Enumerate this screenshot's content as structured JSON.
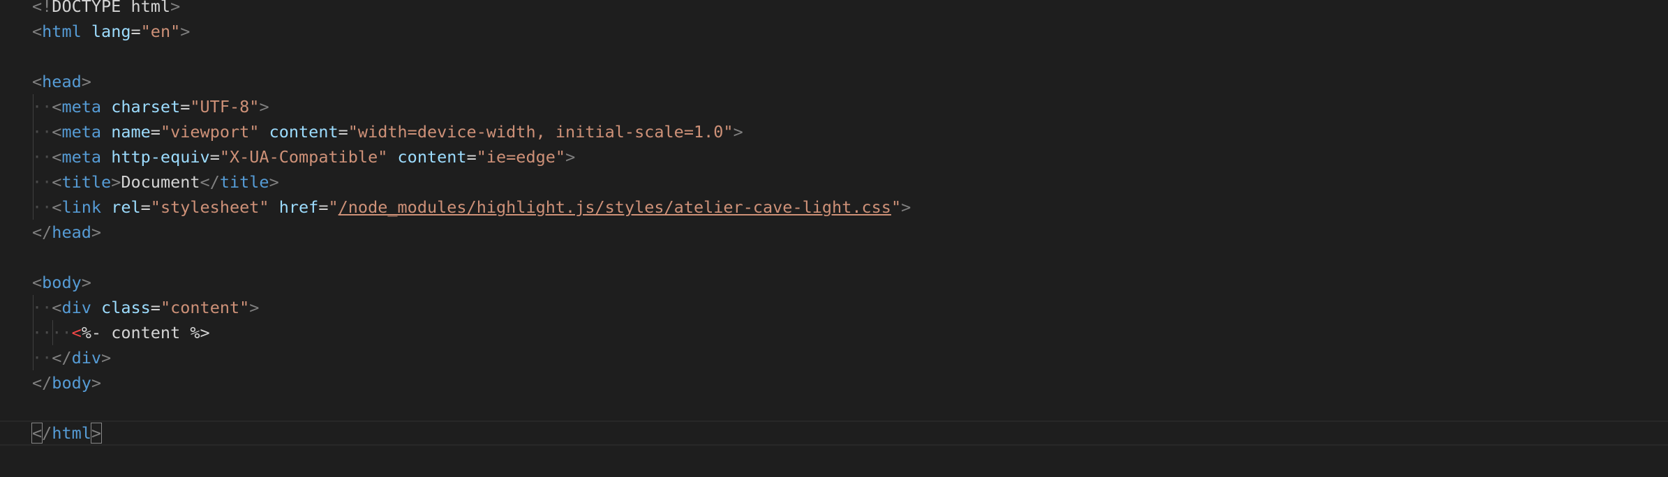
{
  "editor": {
    "language": "html",
    "colors": {
      "background": "#1e1e1e",
      "punctuation": "#808080",
      "tag": "#569cd6",
      "attribute": "#9cdcfe",
      "string": "#ce9178",
      "text": "#d4d4d4",
      "ejs_delimiter": "#f44747"
    },
    "lines": [
      {
        "tokens": [
          {
            "c": "p",
            "v": "<!"
          },
          {
            "c": "x",
            "v": "DOCTYPE html"
          },
          {
            "c": "p",
            "v": ">"
          }
        ]
      },
      {
        "tokens": [
          {
            "c": "p",
            "v": "<"
          },
          {
            "c": "t",
            "v": "html"
          },
          {
            "c": "a",
            "v": " lang"
          },
          {
            "c": "x",
            "v": "="
          },
          {
            "c": "s",
            "v": "\"en\""
          },
          {
            "c": "p",
            "v": ">"
          }
        ]
      },
      {
        "tokens": []
      },
      {
        "tokens": [
          {
            "c": "p",
            "v": "<"
          },
          {
            "c": "t",
            "v": "head"
          },
          {
            "c": "p",
            "v": ">"
          }
        ]
      },
      {
        "tokens": [
          {
            "c": "ws",
            "v": "··"
          },
          {
            "c": "p",
            "v": "<"
          },
          {
            "c": "t",
            "v": "meta"
          },
          {
            "c": "a",
            "v": " charset"
          },
          {
            "c": "x",
            "v": "="
          },
          {
            "c": "s",
            "v": "\"UTF-8\""
          },
          {
            "c": "p",
            "v": ">"
          }
        ]
      },
      {
        "tokens": [
          {
            "c": "ws",
            "v": "··"
          },
          {
            "c": "p",
            "v": "<"
          },
          {
            "c": "t",
            "v": "meta"
          },
          {
            "c": "a",
            "v": " name"
          },
          {
            "c": "x",
            "v": "="
          },
          {
            "c": "s",
            "v": "\"viewport\""
          },
          {
            "c": "a",
            "v": " content"
          },
          {
            "c": "x",
            "v": "="
          },
          {
            "c": "s",
            "v": "\"width=device-width, initial-scale=1.0\""
          },
          {
            "c": "p",
            "v": ">"
          }
        ]
      },
      {
        "tokens": [
          {
            "c": "ws",
            "v": "··"
          },
          {
            "c": "p",
            "v": "<"
          },
          {
            "c": "t",
            "v": "meta"
          },
          {
            "c": "a",
            "v": " http-equiv"
          },
          {
            "c": "x",
            "v": "="
          },
          {
            "c": "s",
            "v": "\"X-UA-Compatible\""
          },
          {
            "c": "a",
            "v": " content"
          },
          {
            "c": "x",
            "v": "="
          },
          {
            "c": "s",
            "v": "\"ie=edge\""
          },
          {
            "c": "p",
            "v": ">"
          }
        ]
      },
      {
        "tokens": [
          {
            "c": "ws",
            "v": "··"
          },
          {
            "c": "p",
            "v": "<"
          },
          {
            "c": "t",
            "v": "title"
          },
          {
            "c": "p",
            "v": ">"
          },
          {
            "c": "x",
            "v": "Document"
          },
          {
            "c": "p",
            "v": "</"
          },
          {
            "c": "t",
            "v": "title"
          },
          {
            "c": "p",
            "v": ">"
          }
        ]
      },
      {
        "tokens": [
          {
            "c": "ws",
            "v": "··"
          },
          {
            "c": "p",
            "v": "<"
          },
          {
            "c": "t",
            "v": "link"
          },
          {
            "c": "a",
            "v": " rel"
          },
          {
            "c": "x",
            "v": "="
          },
          {
            "c": "s",
            "v": "\"stylesheet\""
          },
          {
            "c": "a",
            "v": " href"
          },
          {
            "c": "x",
            "v": "="
          },
          {
            "c": "s",
            "v": "\""
          },
          {
            "c": "u",
            "v": "/node_modules/highlight.js/styles/atelier-cave-light.css"
          },
          {
            "c": "s",
            "v": "\""
          },
          {
            "c": "p",
            "v": ">"
          }
        ]
      },
      {
        "tokens": [
          {
            "c": "p",
            "v": "</"
          },
          {
            "c": "t",
            "v": "head"
          },
          {
            "c": "p",
            "v": ">"
          }
        ]
      },
      {
        "tokens": []
      },
      {
        "tokens": [
          {
            "c": "p",
            "v": "<"
          },
          {
            "c": "t",
            "v": "body"
          },
          {
            "c": "p",
            "v": ">"
          }
        ]
      },
      {
        "tokens": [
          {
            "c": "ws",
            "v": "··"
          },
          {
            "c": "p",
            "v": "<"
          },
          {
            "c": "t",
            "v": "div"
          },
          {
            "c": "a",
            "v": " class"
          },
          {
            "c": "x",
            "v": "="
          },
          {
            "c": "s",
            "v": "\"content\""
          },
          {
            "c": "p",
            "v": ">"
          }
        ]
      },
      {
        "tokens": [
          {
            "c": "ws",
            "v": "····"
          },
          {
            "c": "r",
            "v": "<"
          },
          {
            "c": "x",
            "v": "%- content %>"
          }
        ]
      },
      {
        "tokens": [
          {
            "c": "ws",
            "v": "··"
          },
          {
            "c": "p",
            "v": "</"
          },
          {
            "c": "t",
            "v": "div"
          },
          {
            "c": "p",
            "v": ">"
          }
        ]
      },
      {
        "tokens": [
          {
            "c": "p",
            "v": "</"
          },
          {
            "c": "t",
            "v": "body"
          },
          {
            "c": "p",
            "v": ">"
          }
        ]
      },
      {
        "tokens": []
      },
      {
        "tokens": [
          {
            "c": "p bm",
            "v": "<"
          },
          {
            "c": "p",
            "v": "/"
          },
          {
            "c": "t",
            "v": "html"
          },
          {
            "c": "p bm",
            "v": ">"
          }
        ]
      }
    ]
  }
}
